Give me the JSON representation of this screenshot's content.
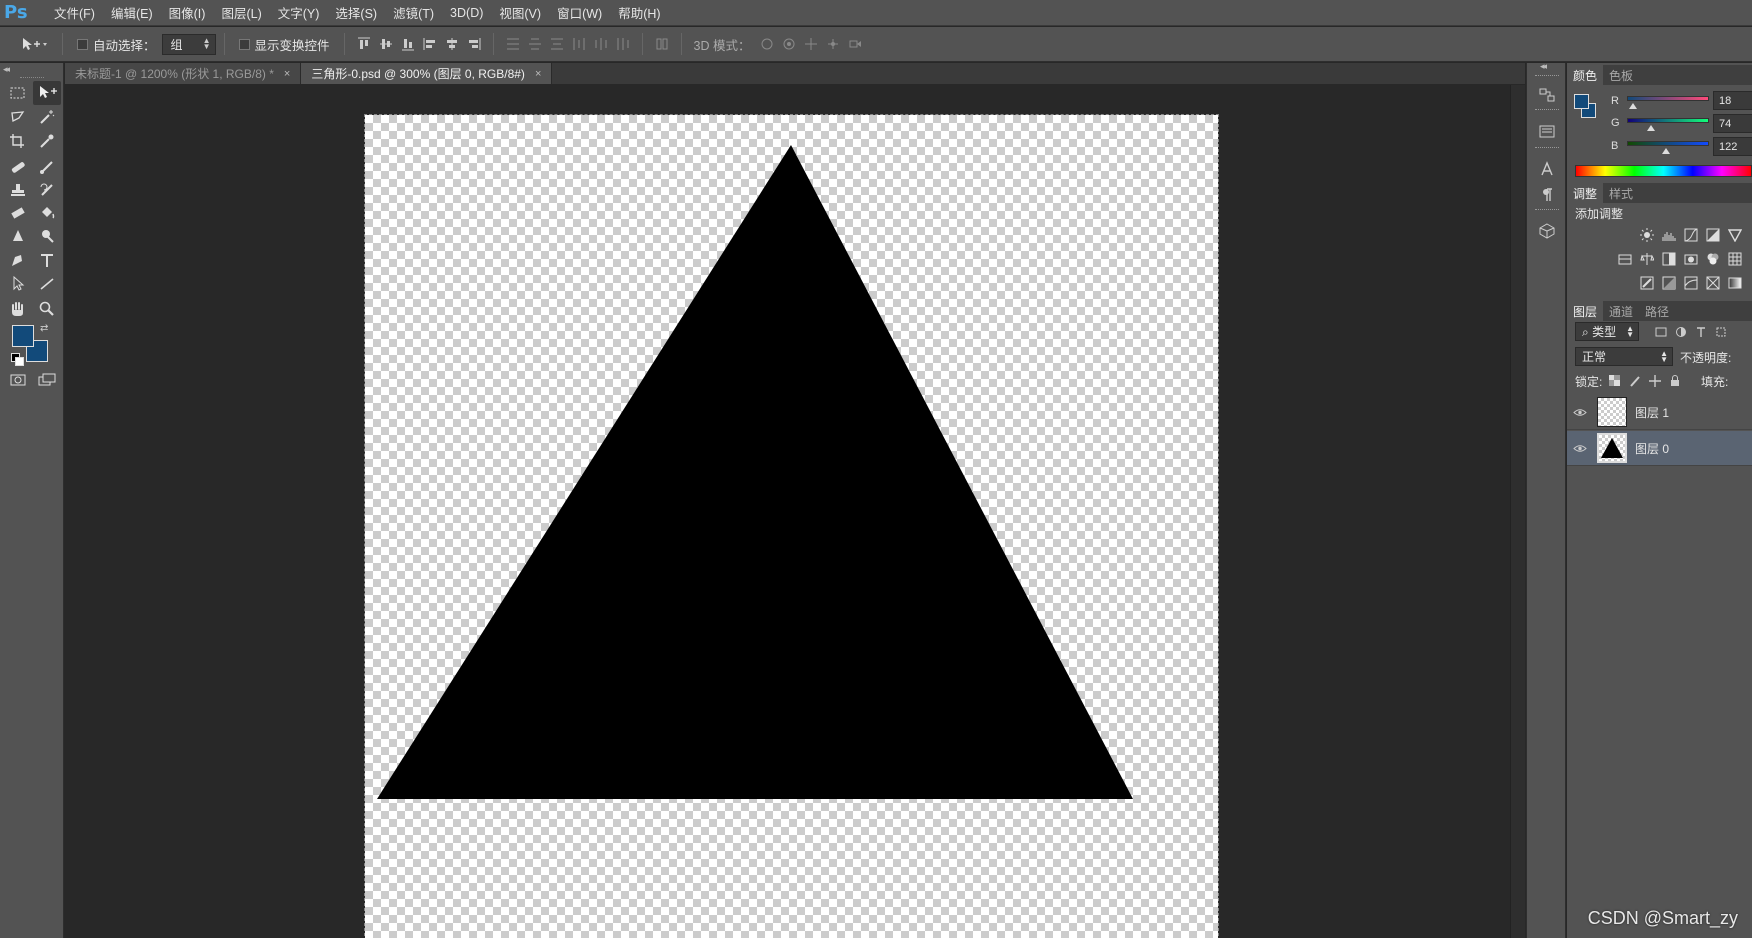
{
  "app": {
    "logo": "Ps",
    "menu": [
      "文件(F)",
      "编辑(E)",
      "图像(I)",
      "图层(L)",
      "文字(Y)",
      "选择(S)",
      "滤镜(T)",
      "3D(D)",
      "视图(V)",
      "窗口(W)",
      "帮助(H)"
    ]
  },
  "options": {
    "auto_select_label": "自动选择：",
    "auto_select_value": "组",
    "show_transform_label": "显示变换控件",
    "mode_3d_label": "3D 模式："
  },
  "tabs": [
    {
      "label": "未标题-1 @ 1200% (形状 1, RGB/8) *",
      "close": "×",
      "active": false
    },
    {
      "label": "三角形-0.psd @ 300% (图层 0, RGB/8#)",
      "close": "×",
      "active": true
    }
  ],
  "colors": {
    "foreground": "#124a7a",
    "background": "#124a7a",
    "triangle_fill": "#000000"
  },
  "color_panel": {
    "tabs": [
      "颜色",
      "色板"
    ],
    "channels": [
      {
        "label": "R",
        "value": "18",
        "fraction": 0.07
      },
      {
        "label": "G",
        "value": "74",
        "fraction": 0.29
      },
      {
        "label": "B",
        "value": "122",
        "fraction": 0.48
      }
    ]
  },
  "adjust_panel": {
    "tabs": [
      "调整",
      "样式"
    ],
    "title": "添加调整"
  },
  "layers_panel": {
    "tabs": [
      "图层",
      "通道",
      "路径"
    ],
    "filter_label": "类型",
    "blend_mode": "正常",
    "opacity_label": "不透明度:",
    "lock_label": "锁定:",
    "fill_label": "填充:",
    "layers": [
      {
        "name": "图层 1",
        "visible": true,
        "selected": false,
        "thumb": "transparent"
      },
      {
        "name": "图层 0",
        "visible": true,
        "selected": true,
        "thumb": "triangle"
      }
    ]
  },
  "watermark": "CSDN @Smart_zy"
}
